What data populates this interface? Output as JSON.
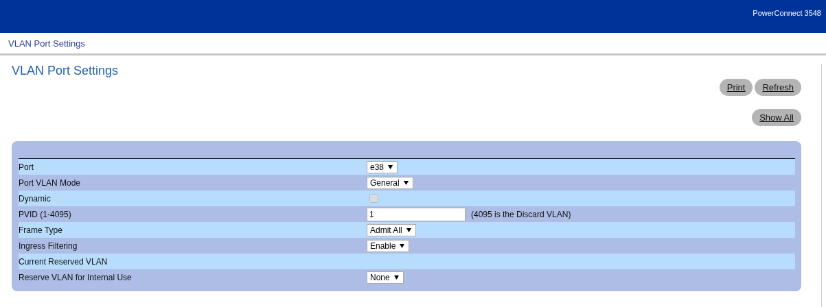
{
  "header": {
    "product": "PowerConnect 3548"
  },
  "breadcrumb": "VLAN Port Settings",
  "title": "VLAN Port Settings",
  "button_groups": [
    [
      "Print",
      "Refresh"
    ],
    [
      "Show All"
    ]
  ],
  "form": {
    "rows": [
      {
        "label": "Port",
        "kind": "select",
        "value": "e38"
      },
      {
        "label": "Port VLAN Mode",
        "kind": "select",
        "value": "General"
      },
      {
        "label": "Dynamic",
        "kind": "checkbox",
        "checked": false,
        "disabled": true
      },
      {
        "label": "PVID (1-4095)",
        "kind": "input",
        "value": "1",
        "note": "(4095 is the Discard VLAN)"
      },
      {
        "label": "Frame Type",
        "kind": "select",
        "value": "Admit All"
      },
      {
        "label": "Ingress Filtering",
        "kind": "select",
        "value": "Enable"
      },
      {
        "label": "Current Reserved VLAN",
        "kind": "empty"
      },
      {
        "label": "Reserve VLAN for Internal Use",
        "kind": "select",
        "value": "None"
      }
    ]
  }
}
